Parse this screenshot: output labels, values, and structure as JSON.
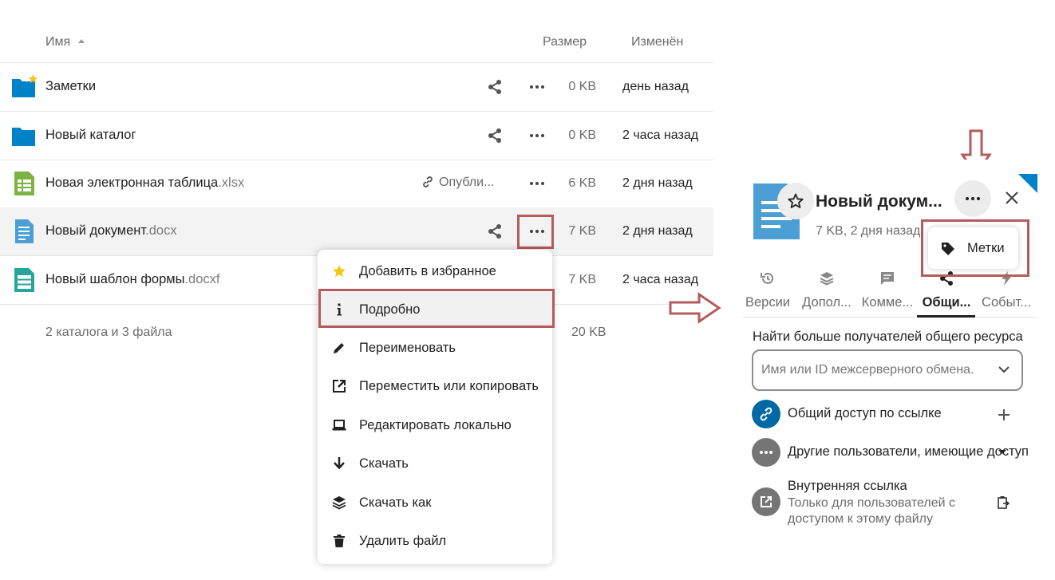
{
  "table": {
    "col_name": "Имя",
    "col_size": "Размер",
    "col_modified": "Изменён",
    "rows": [
      {
        "name": "Заметки",
        "ext": "",
        "size": "0 KB",
        "modified": "день назад",
        "published": ""
      },
      {
        "name": "Новый каталог",
        "ext": "",
        "size": "0 KB",
        "modified": "2 часа назад",
        "published": ""
      },
      {
        "name": "Новая электронная таблица",
        "ext": ".xlsx",
        "size": "6 KB",
        "modified": "2 дня назад",
        "published": "Опубли..."
      },
      {
        "name": "Новый документ",
        "ext": ".docx",
        "size": "7 KB",
        "modified": "2 дня назад",
        "published": ""
      },
      {
        "name": "Новый шаблон формы",
        "ext": ".docxf",
        "size": "7 KB",
        "modified": "2 часа назад",
        "published": ""
      }
    ],
    "summary": "2 каталога и 3 файла",
    "summary_size": "20 KB"
  },
  "context_menu": {
    "items": [
      {
        "label": "Добавить в избранное",
        "icon": "star-icon"
      },
      {
        "label": "Подробно",
        "icon": "info-icon"
      },
      {
        "label": "Переименовать",
        "icon": "pencil-icon"
      },
      {
        "label": "Переместить или копировать",
        "icon": "external-link-icon"
      },
      {
        "label": "Редактировать локально",
        "icon": "laptop-icon"
      },
      {
        "label": "Скачать",
        "icon": "download-icon"
      },
      {
        "label": "Скачать как",
        "icon": "layers-icon"
      },
      {
        "label": "Удалить файл",
        "icon": "trash-icon"
      }
    ]
  },
  "sidebar": {
    "title": "Новый докум...",
    "subtitle": "7 KB, 2 дня назад",
    "popover_label": "Метки",
    "tabs": [
      {
        "label": "Версии",
        "icon": "history-icon"
      },
      {
        "label": "Допол...",
        "icon": "layers-icon"
      },
      {
        "label": "Комме...",
        "icon": "comment-icon"
      },
      {
        "label": "Общи...",
        "icon": "share-icon"
      },
      {
        "label": "Событ...",
        "icon": "activity-icon"
      }
    ],
    "find_label": "Найти больше получателей общего ресурса",
    "search_placeholder": "Имя или ID межсерверного обмена.",
    "share_link_label": "Общий доступ по ссылке",
    "others_label": "Другие пользователи, имеющие доступ",
    "internal_link_label": "Внутренняя ссылка",
    "internal_link_sub": "Только для пользователей с доступом к этому файлу"
  },
  "colors": {
    "folder_blue": "#0082c9",
    "annotation_red": "#b55b5b",
    "xlsx_green": "#7cb342",
    "doc_blue": "#4b9fd5",
    "form_teal": "#26a69a",
    "star_yellow": "#f5c518"
  }
}
